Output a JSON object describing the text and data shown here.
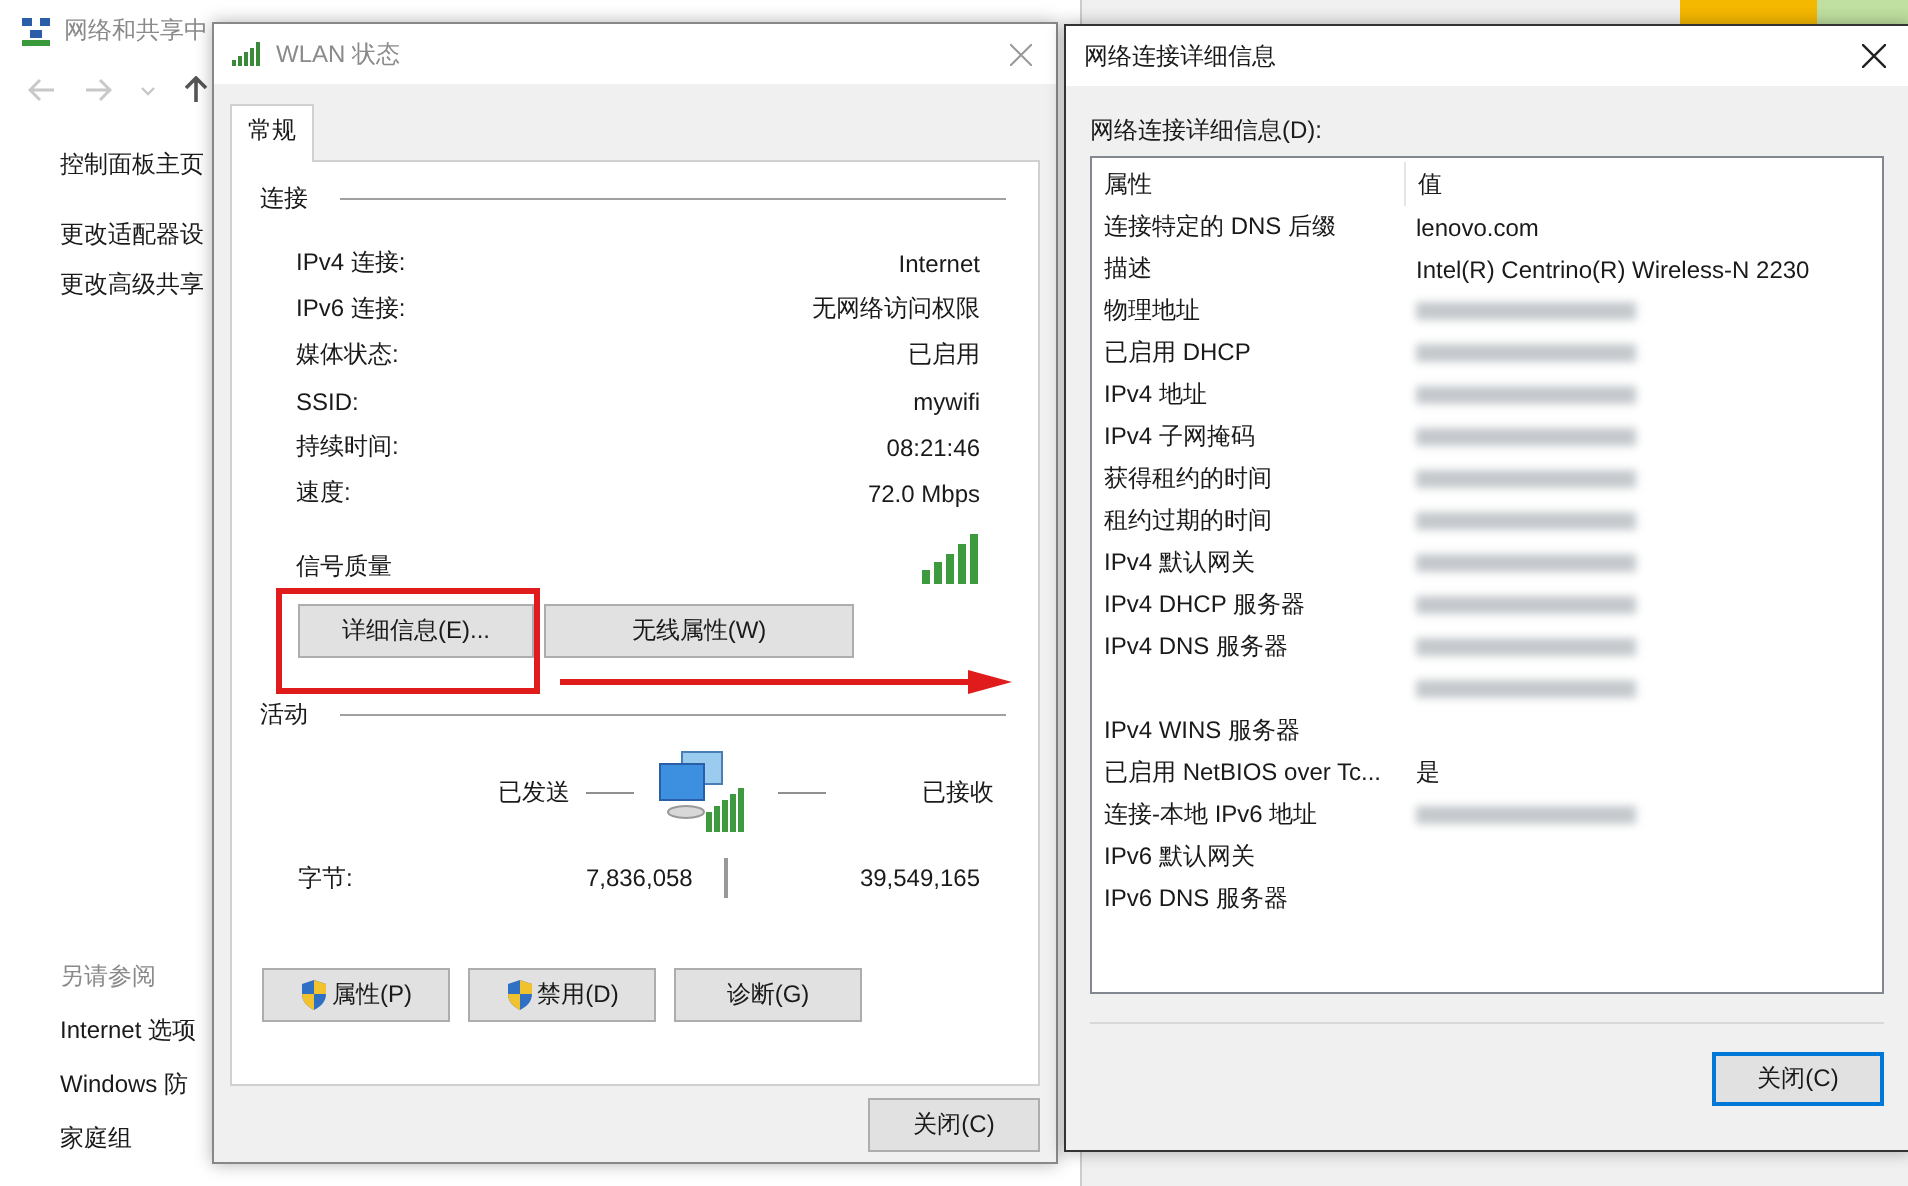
{
  "background_window": {
    "title": "网络和共享中",
    "links": [
      "控制面板主页",
      "更改适配器设",
      "更改高级共享"
    ],
    "see_also": {
      "heading": "另请参阅",
      "links": [
        "Internet 选项",
        "Windows 防",
        "家庭组"
      ]
    }
  },
  "wlan_dialog": {
    "title": "WLAN 状态",
    "tabs": [
      {
        "label": "常规",
        "selected": true
      }
    ],
    "connection": {
      "heading": "连接",
      "rows": [
        {
          "label": "IPv4 连接:",
          "value": "Internet"
        },
        {
          "label": "IPv6 连接:",
          "value": "无网络访问权限"
        },
        {
          "label": "媒体状态:",
          "value": "已启用"
        },
        {
          "label": "SSID:",
          "value": "mywifi"
        },
        {
          "label": "持续时间:",
          "value": "08:21:46"
        },
        {
          "label": "速度:",
          "value": "72.0 Mbps"
        }
      ],
      "signal_label": "信号质量"
    },
    "buttons": [
      "详细信息(E)...",
      "无线属性(W)"
    ],
    "activity": {
      "heading": "活动",
      "sent_label": "已发送",
      "received_label": "已接收",
      "bytes_label": "字节:",
      "bytes_sent": "7,836,058",
      "bytes_received": "39,549,165"
    },
    "action_buttons": [
      {
        "label": "属性(P)",
        "shield": true
      },
      {
        "label": "禁用(D)",
        "shield": true
      },
      {
        "label": "诊断(G)",
        "shield": false
      }
    ],
    "close_button": "关闭(C)"
  },
  "details_dialog": {
    "title": "网络连接详细信息",
    "list_label": "网络连接详细信息(D):",
    "columns": [
      "属性",
      "值"
    ],
    "rows": [
      {
        "property": "连接特定的 DNS 后缀",
        "value": "lenovo.com"
      },
      {
        "property": "描述",
        "value": "Intel(R) Centrino(R) Wireless-N 2230"
      },
      {
        "property": "物理地址",
        "blurred": true
      },
      {
        "property": "已启用 DHCP",
        "blurred": true
      },
      {
        "property": "IPv4 地址",
        "blurred": true
      },
      {
        "property": "IPv4 子网掩码",
        "blurred": true
      },
      {
        "property": "获得租约的时间",
        "blurred": true
      },
      {
        "property": "租约过期的时间",
        "blurred": true
      },
      {
        "property": "IPv4 默认网关",
        "blurred": true
      },
      {
        "property": "IPv4 DHCP 服务器",
        "blurred": true
      },
      {
        "property": "IPv4 DNS 服务器",
        "blurred": true
      },
      {
        "blurred": true
      },
      {
        "property": "IPv4 WINS 服务器"
      },
      {
        "property": "已启用 NetBIOS over Tc...",
        "value": "是"
      },
      {
        "property": "连接-本地 IPv6 地址",
        "blurred": true
      },
      {
        "property": "IPv6 默认网关"
      },
      {
        "property": "IPv6 DNS 服务器"
      }
    ],
    "close_button": "关闭(C)",
    "close_default": true
  }
}
